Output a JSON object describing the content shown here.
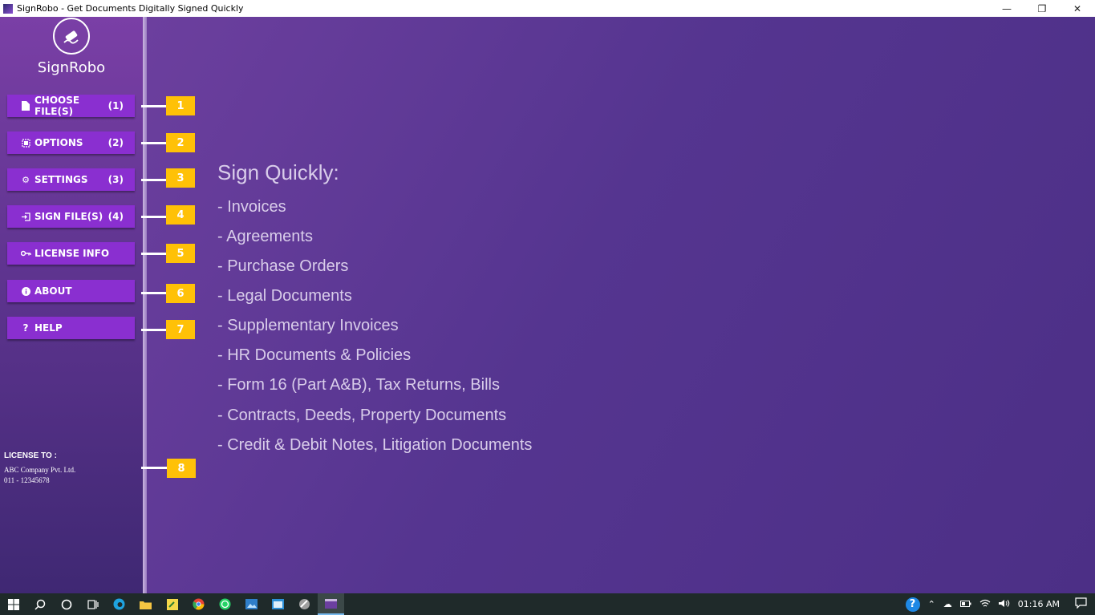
{
  "window": {
    "title": "SignRobo - Get Documents Digitally Signed Quickly",
    "controls": [
      "minimize-icon",
      "restore-icon",
      "close-icon"
    ]
  },
  "sidebar": {
    "logo_text": "SignRobo",
    "buttons": [
      {
        "label": "CHOOSE FILE(S)",
        "number": "(1)",
        "icon": "file-icon",
        "marker": "1"
      },
      {
        "label": "OPTIONS",
        "number": "(2)",
        "icon": "options-icon",
        "marker": "2"
      },
      {
        "label": "SETTINGS",
        "number": "(3)",
        "icon": "gear-icon",
        "marker": "3"
      },
      {
        "label": "SIGN FILE(S)",
        "number": "(4)",
        "icon": "sign-in-icon",
        "marker": "4"
      },
      {
        "label": "LICENSE INFO",
        "number": "",
        "icon": "key-icon",
        "marker": "5"
      },
      {
        "label": "ABOUT",
        "number": "",
        "icon": "info-icon",
        "marker": "6"
      },
      {
        "label": "HELP",
        "number": "",
        "icon": "question-icon",
        "marker": "7"
      }
    ],
    "license": {
      "heading": "LICENSE TO :",
      "company": "ABC Company Pvt. Ltd.",
      "phone": "011 - 12345678",
      "marker": "8"
    }
  },
  "main": {
    "headline": "Sign Quickly:",
    "items": [
      "- Invoices",
      "- Agreements",
      "- Purchase Orders",
      "- Legal Documents",
      "- Supplementary Invoices",
      "- HR Documents & Policies",
      "- Form 16 (Part A&B), Tax Returns, Bills",
      "- Contracts, Deeds, Property Documents",
      "- Credit & Debit Notes, Litigation Documents"
    ]
  },
  "taskbar": {
    "time": "01:16 AM",
    "help_symbol": "?"
  },
  "colors": {
    "button": "#8a2fd0",
    "marker": "#ffc107",
    "text_light": "#d9cdea"
  }
}
